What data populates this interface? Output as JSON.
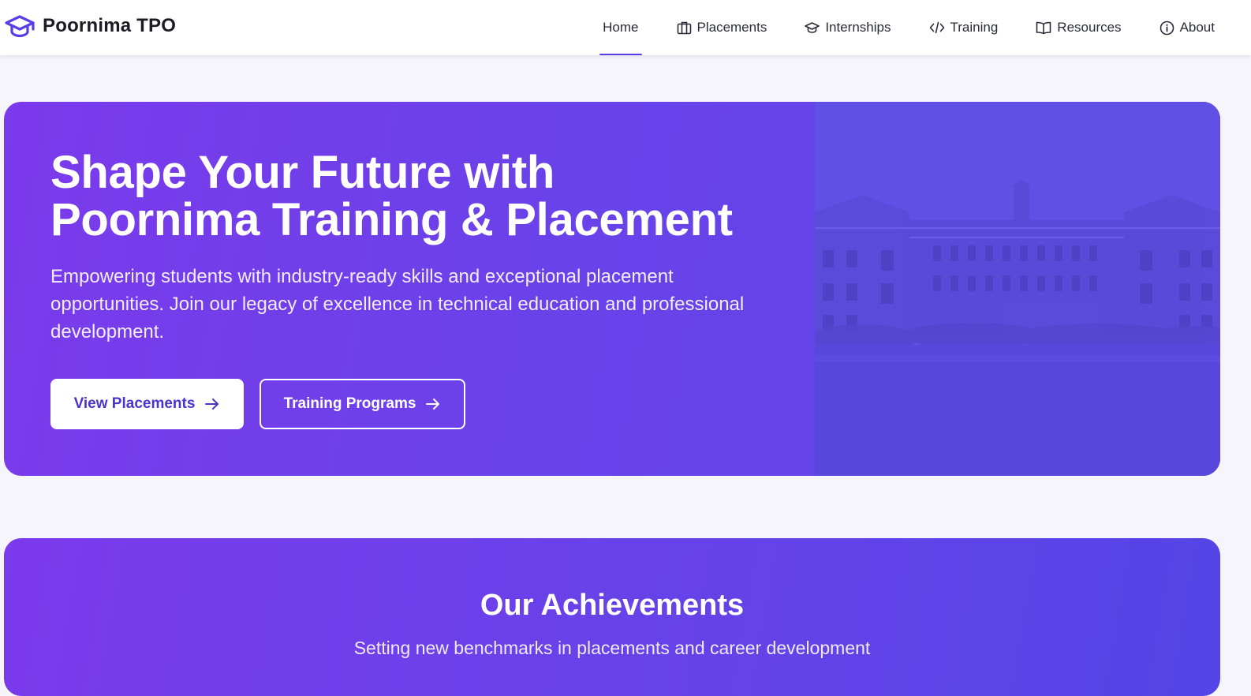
{
  "navbar": {
    "brand": {
      "name": "Poornima TPO",
      "icon": "graduation-cap-icon"
    },
    "items": [
      {
        "label": "Home",
        "icon": "",
        "active": true
      },
      {
        "label": "Placements",
        "icon": "briefcase-icon",
        "active": false
      },
      {
        "label": "Internships",
        "icon": "graduation-cap-icon",
        "active": false
      },
      {
        "label": "Training",
        "icon": "code-icon",
        "active": false
      },
      {
        "label": "Resources",
        "icon": "book-open-icon",
        "active": false
      },
      {
        "label": "About",
        "icon": "info-icon",
        "active": false
      }
    ],
    "accent": "#5b3de8"
  },
  "hero": {
    "title_line1": "Shape Your Future with",
    "title_line2": "Poornima Training & Placement",
    "subtitle": "Empowering students with industry-ready skills and exceptional placement opportunities. Join our legacy of excellence in technical education and professional development.",
    "buttons": {
      "primary": {
        "label": "View Placements",
        "icon": "arrow-right-icon"
      },
      "secondary": {
        "label": "Training Programs",
        "icon": "arrow-right-icon"
      }
    },
    "image": "campus-building-image",
    "gradient_start": "#7b3aeb",
    "gradient_end": "#5a46e6"
  },
  "achievements": {
    "title": "Our Achievements",
    "subtitle": "Setting new benchmarks in placements and career development"
  }
}
